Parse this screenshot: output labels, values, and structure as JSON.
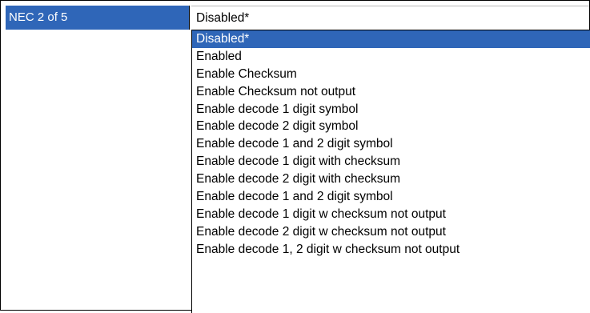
{
  "property": {
    "label": "NEC 2 of 5",
    "current_value": "Disabled*"
  },
  "dropdown": {
    "selected_index": 0,
    "options": [
      "Disabled*",
      "Enabled",
      "Enable Checksum",
      "Enable Checksum not output",
      "Enable decode 1 digit symbol",
      "Enable decode 2 digit symbol",
      "Enable decode 1 and 2 digit symbol",
      "Enable decode 1 digit with checksum",
      "Enable decode 2 digit with checksum",
      "Enable decode 1 and 2 digit symbol",
      "Enable decode 1 digit w checksum not output",
      "Enable decode 2 digit w checksum not output",
      "Enable decode 1, 2 digit w checksum not output"
    ]
  },
  "colors": {
    "selection": "#2f66b8",
    "selection_text": "#ffffff",
    "border": "#000000"
  }
}
